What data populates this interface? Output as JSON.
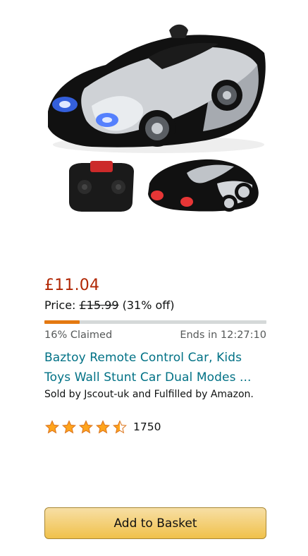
{
  "product": {
    "price": "£11.04",
    "was_label": "Price: ",
    "was_price": "£15.99",
    "discount": "(31% off)",
    "claimed_fraction": 0.16,
    "claimed_text": "16% Claimed",
    "ends_text": "Ends in 12:27:10",
    "title_line1": "Baztoy Remote Control Car, Kids",
    "title_line2": "Toys Wall Stunt Car Dual Modes ...",
    "seller": "Sold by Jscout-uk and Fulfilled by Amazon.",
    "rating_value": 4.5,
    "rating_count": "1750",
    "add_button_label": "Add to Basket"
  },
  "colors": {
    "price": "#b12704",
    "link": "#007185",
    "progress": "#e47911",
    "star": "#ffa41c",
    "button": "#f0c14b"
  }
}
